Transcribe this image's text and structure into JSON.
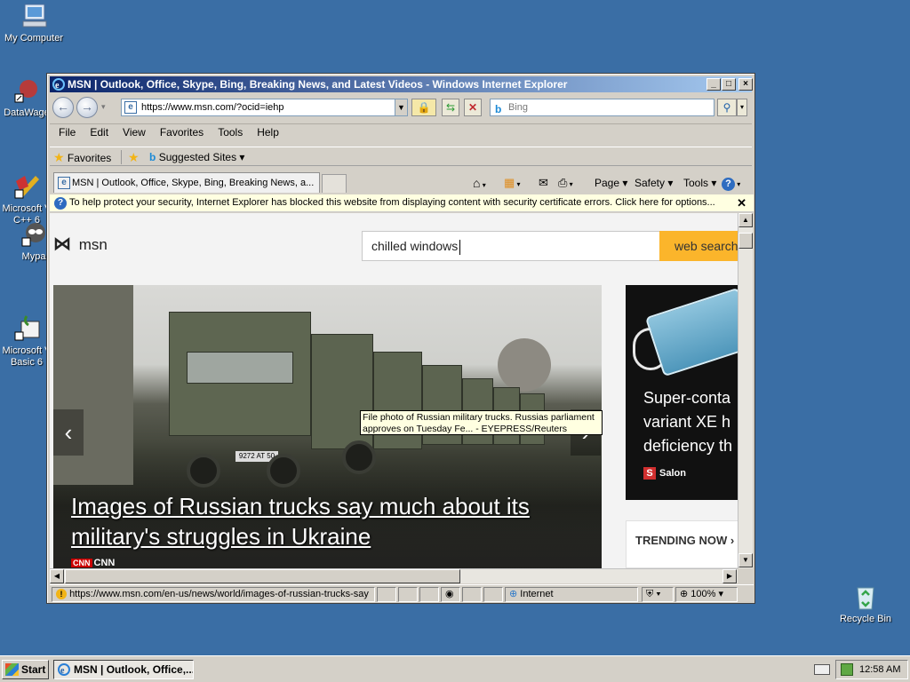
{
  "desktop": {
    "icons": [
      {
        "label": "My Computer"
      },
      {
        "label": "DataWage"
      },
      {
        "label": "Microsoft V\nC++ 6"
      },
      {
        "label": "Mypa"
      },
      {
        "label": "Microsoft V\nBasic 6"
      },
      {
        "label": "Recycle Bin"
      }
    ]
  },
  "window": {
    "title": "MSN | Outlook, Office, Skype, Bing, Breaking News, and Latest Videos - Windows Internet Explorer",
    "controls": {
      "minimize": "_",
      "maximize": "□",
      "close": "×"
    }
  },
  "addressbar": {
    "url": "https://www.msn.com/?ocid=iehp",
    "search_placeholder": "Bing"
  },
  "menu": [
    "File",
    "Edit",
    "View",
    "Favorites",
    "Tools",
    "Help"
  ],
  "favorites": {
    "label": "Favorites",
    "suggested": "Suggested Sites ▾"
  },
  "tab": {
    "label": "MSN | Outlook, Office, Skype, Bing, Breaking News, a..."
  },
  "commandbar": {
    "page": "Page ▾",
    "safety": "Safety ▾",
    "tools": "Tools ▾"
  },
  "infobar": {
    "text": "To help protect your security, Internet Explorer has blocked this website from displaying content with security certificate errors. Click here for options...",
    "close": "✕"
  },
  "msn": {
    "logo": "msn",
    "search_value": "chilled windows",
    "search_button": "web search"
  },
  "hero": {
    "headline": "Images of Russian trucks say much about its military's struggles in Ukraine",
    "source": "CNN",
    "truck_plate": "9272 AT 50"
  },
  "side_card": {
    "text_lines": [
      "Super-conta",
      "variant XE h",
      "deficiency th"
    ],
    "source": "Salon"
  },
  "trending": {
    "label": "TRENDING NOW ›"
  },
  "tooltip": {
    "text": "File photo of Russian military trucks. Russias parliament approves on Tuesday Fe... - EYEPRESS/Reuters"
  },
  "status": {
    "url": "https://www.msn.com/en-us/news/world/images-of-russian-trucks-say",
    "zone": "Internet",
    "zoom": "100%"
  },
  "taskbar": {
    "start": "Start",
    "task": "MSN | Outlook, Office,...",
    "clock": "12:58 AM"
  },
  "colors": {
    "desktop": "#3a6ea5",
    "title_gradient_start": "#0a246a",
    "websearch": "#fbb52b",
    "infobar": "#ffffe1"
  }
}
